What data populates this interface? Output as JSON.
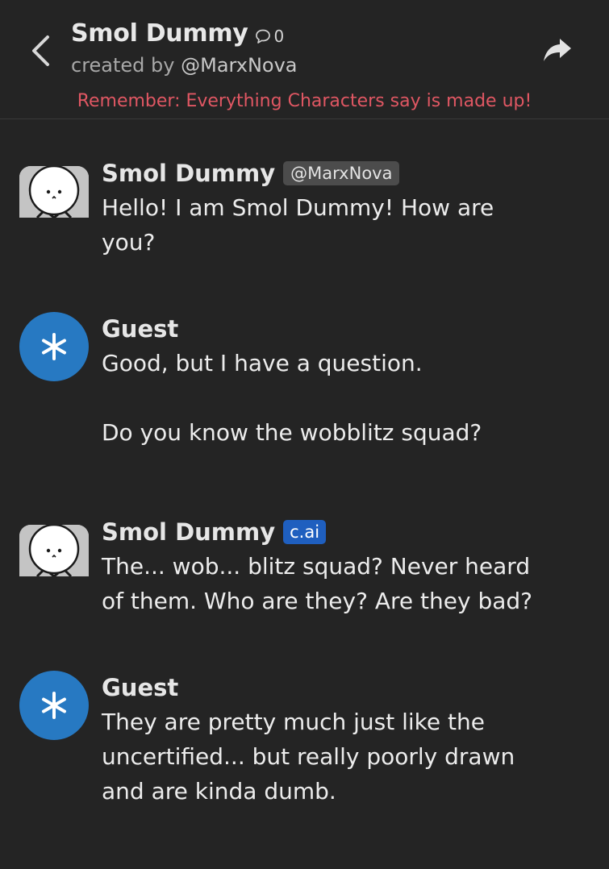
{
  "header": {
    "title": "Smol Dummy",
    "chat_count": "0",
    "created_by_prefix": "created by",
    "creator_handle": "@MarxNova",
    "disclaimer": "Remember: Everything Characters say is made up!"
  },
  "icons": {
    "back": "back-chevron-icon",
    "chat_bubble": "chat-bubble-icon",
    "share": "share-arrow-icon",
    "guest_avatar": "asterisk-icon"
  },
  "colors": {
    "background": "#242424",
    "disclaimer": "#e05763",
    "guest_avatar": "#2779c2",
    "ai_tag": "#1f5fbf",
    "handle_tag": "#4c4c4c"
  },
  "messages": [
    {
      "sender": "Smol Dummy",
      "tag": "@MarxNova",
      "text": "Hello! I am Smol Dummy! How are\nyou?"
    },
    {
      "sender": "Guest",
      "tag": "",
      "text": "Good, but I have a question.\n\nDo you know the wobblitz squad?"
    },
    {
      "sender": "Smol Dummy",
      "tag": "c.ai",
      "text": "The... wob... blitz squad? Never heard\nof them. Who are they? Are they bad?"
    },
    {
      "sender": "Guest",
      "tag": "",
      "text": "They are pretty much just like the\nuncertified... but really poorly drawn\nand are kinda dumb."
    }
  ]
}
